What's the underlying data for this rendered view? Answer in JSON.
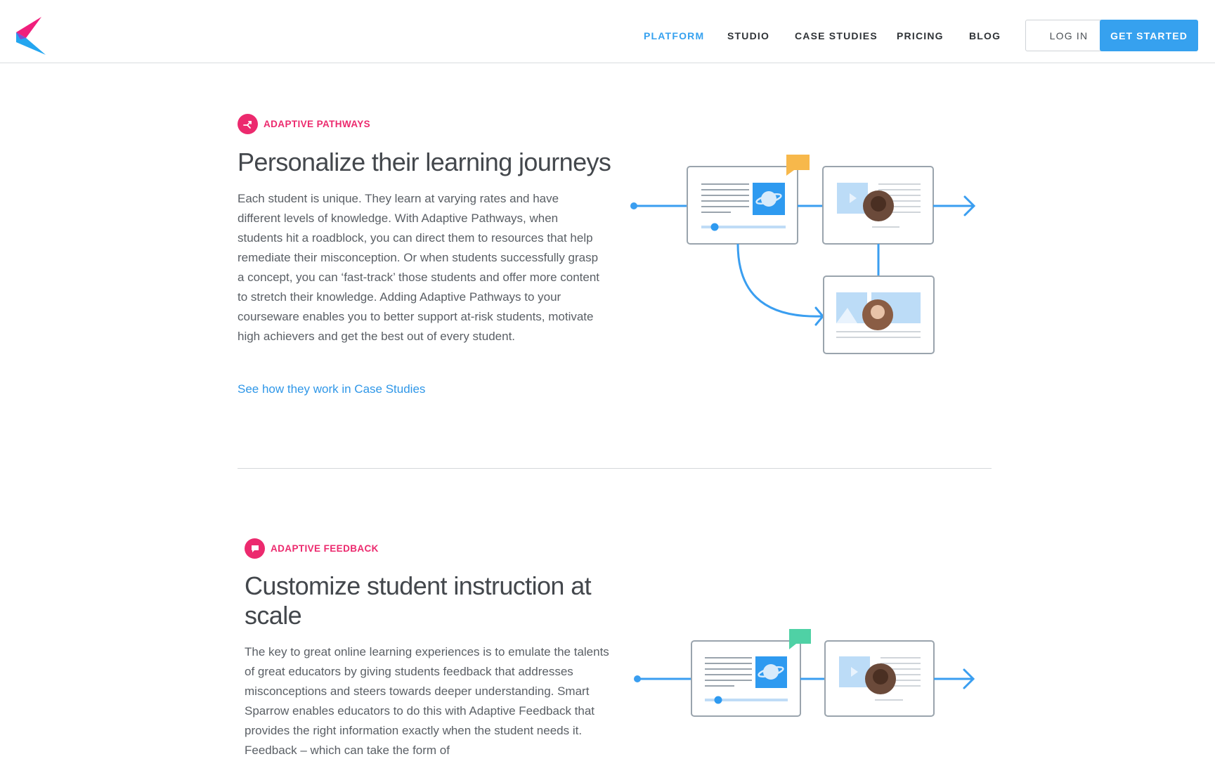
{
  "header": {
    "nav": [
      {
        "label": "PLATFORM",
        "active": true
      },
      {
        "label": "STUDIO",
        "active": false
      },
      {
        "label": "CASE STUDIES",
        "active": false
      },
      {
        "label": "PRICING",
        "active": false
      },
      {
        "label": "BLOG",
        "active": false
      }
    ],
    "login_label": "LOG IN",
    "get_started_label": "GET STARTED"
  },
  "sections": [
    {
      "eyebrow": "ADAPTIVE PATHWAYS",
      "title": "Personalize their learning journeys",
      "body": "Each student is unique. They learn at varying rates and have different levels of knowledge. With Adaptive Pathways, when students hit a roadblock, you can direct them to resources that help remediate their misconception. Or when students successfully grasp a concept, you can ‘fast-track’ those students and offer more content to stretch their knowledge. Adding Adaptive Pathways to your courseware enables you to better support at-risk students, motivate high achievers and get the best out of every student.",
      "link": "See how they work in Case Studies"
    },
    {
      "eyebrow": "ADAPTIVE FEEDBACK",
      "title": "Customize student instruction at scale",
      "body": "The key to great online learning experiences is to emulate the talents of great educators by giving students feedback that addresses misconceptions and steers towards deeper understanding. Smart Sparrow enables educators to do this with Adaptive Feedback that provides the right information exactly when the student needs it. Feedback – which can take the form of"
    }
  ],
  "colors": {
    "accent_blue": "#36a1ef",
    "accent_pink": "#ec2a6e",
    "flag_orange": "#f7b84b",
    "flag_green": "#4fd1a5"
  },
  "icons": {
    "logo": "logo-k-mark",
    "pathways": "split-arrow-icon",
    "feedback": "speech-bubble-icon"
  }
}
